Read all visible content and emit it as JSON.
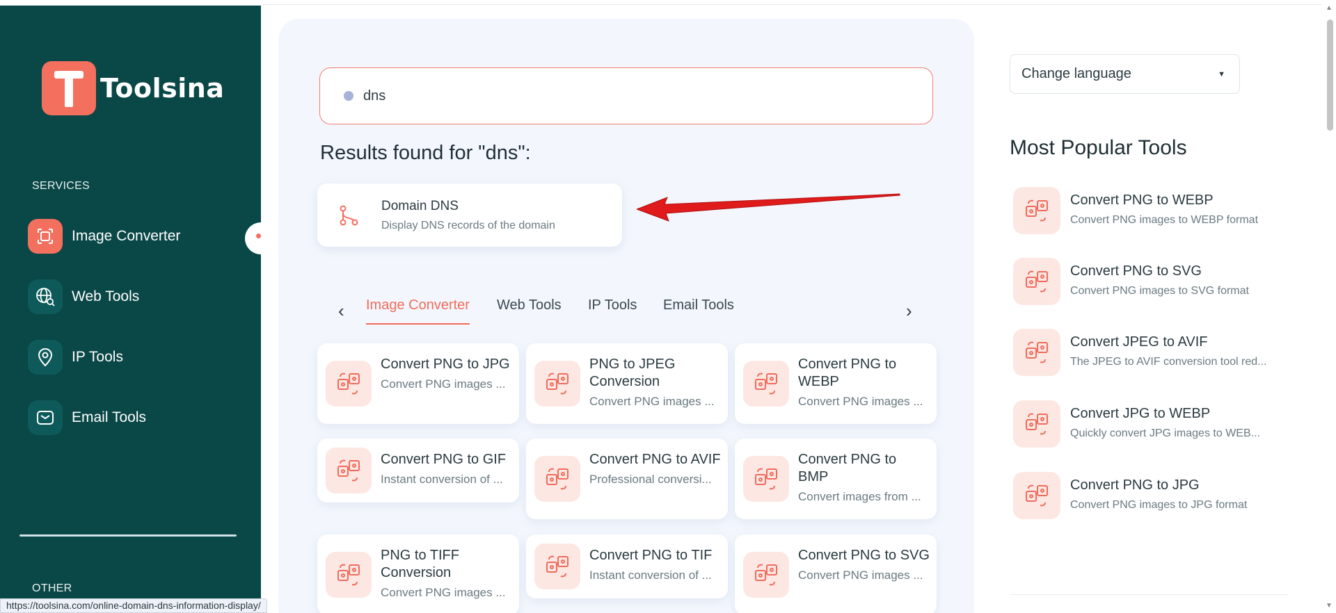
{
  "brand": {
    "name": "Toolsina"
  },
  "sidebar": {
    "services_label": "SERVICES",
    "other_label": "OTHER",
    "items": [
      {
        "label": "Image Converter",
        "icon": "image-converter-icon",
        "active": true
      },
      {
        "label": "Web Tools",
        "icon": "globe-search-icon",
        "active": false
      },
      {
        "label": "IP Tools",
        "icon": "location-pin-icon",
        "active": false
      },
      {
        "label": "Email Tools",
        "icon": "envelope-icon",
        "active": false
      }
    ]
  },
  "search": {
    "value": "dns",
    "placeholder": ""
  },
  "results": {
    "title": "Results found for \"dns\":",
    "items": [
      {
        "title": "Domain DNS",
        "desc": "Display DNS records of the domain",
        "icon": "branch-icon"
      }
    ]
  },
  "tabs": {
    "prev": "‹",
    "next": "›",
    "items": [
      {
        "label": "Image Converter",
        "active": true
      },
      {
        "label": "Web Tools",
        "active": false
      },
      {
        "label": "IP Tools",
        "active": false
      },
      {
        "label": "Email Tools",
        "active": false
      }
    ]
  },
  "tools": [
    {
      "title": "Convert PNG to JPG",
      "desc": "Convert PNG images ..."
    },
    {
      "title": "PNG to JPEG Conversion",
      "desc": "Convert PNG images ..."
    },
    {
      "title": "Convert PNG to WEBP",
      "desc": "Convert PNG images ..."
    },
    {
      "title": "Convert PNG to GIF",
      "desc": "Instant conversion of ..."
    },
    {
      "title": "Convert PNG to AVIF",
      "desc": "Professional conversi..."
    },
    {
      "title": "Convert PNG to BMP",
      "desc": "Convert images from ..."
    },
    {
      "title": "PNG to TIFF Conversion",
      "desc": "Convert PNG images ..."
    },
    {
      "title": "Convert PNG to TIF",
      "desc": "Instant conversion of ..."
    },
    {
      "title": "Convert PNG to SVG",
      "desc": "Convert PNG images ..."
    }
  ],
  "language": {
    "label": "Change language",
    "caret": "▼"
  },
  "popular": {
    "title": "Most Popular Tools",
    "items": [
      {
        "title": "Convert PNG to WEBP",
        "desc": "Convert PNG images to WEBP format"
      },
      {
        "title": "Convert PNG to SVG",
        "desc": "Convert PNG images to SVG format"
      },
      {
        "title": "Convert JPEG to AVIF",
        "desc": "The JPEG to AVIF conversion tool red..."
      },
      {
        "title": "Convert JPG to WEBP",
        "desc": "Quickly convert JPG images to WEB..."
      },
      {
        "title": "Convert PNG to JPG",
        "desc": "Convert PNG images to JPG format"
      }
    ]
  },
  "status_url": "https://toolsina.com/online-domain-dns-information-display/",
  "colors": {
    "sidebar": "#0a4747",
    "accent": "#f36f5e",
    "panel": "#f3f7fd",
    "arrow": "#e01b1b"
  }
}
